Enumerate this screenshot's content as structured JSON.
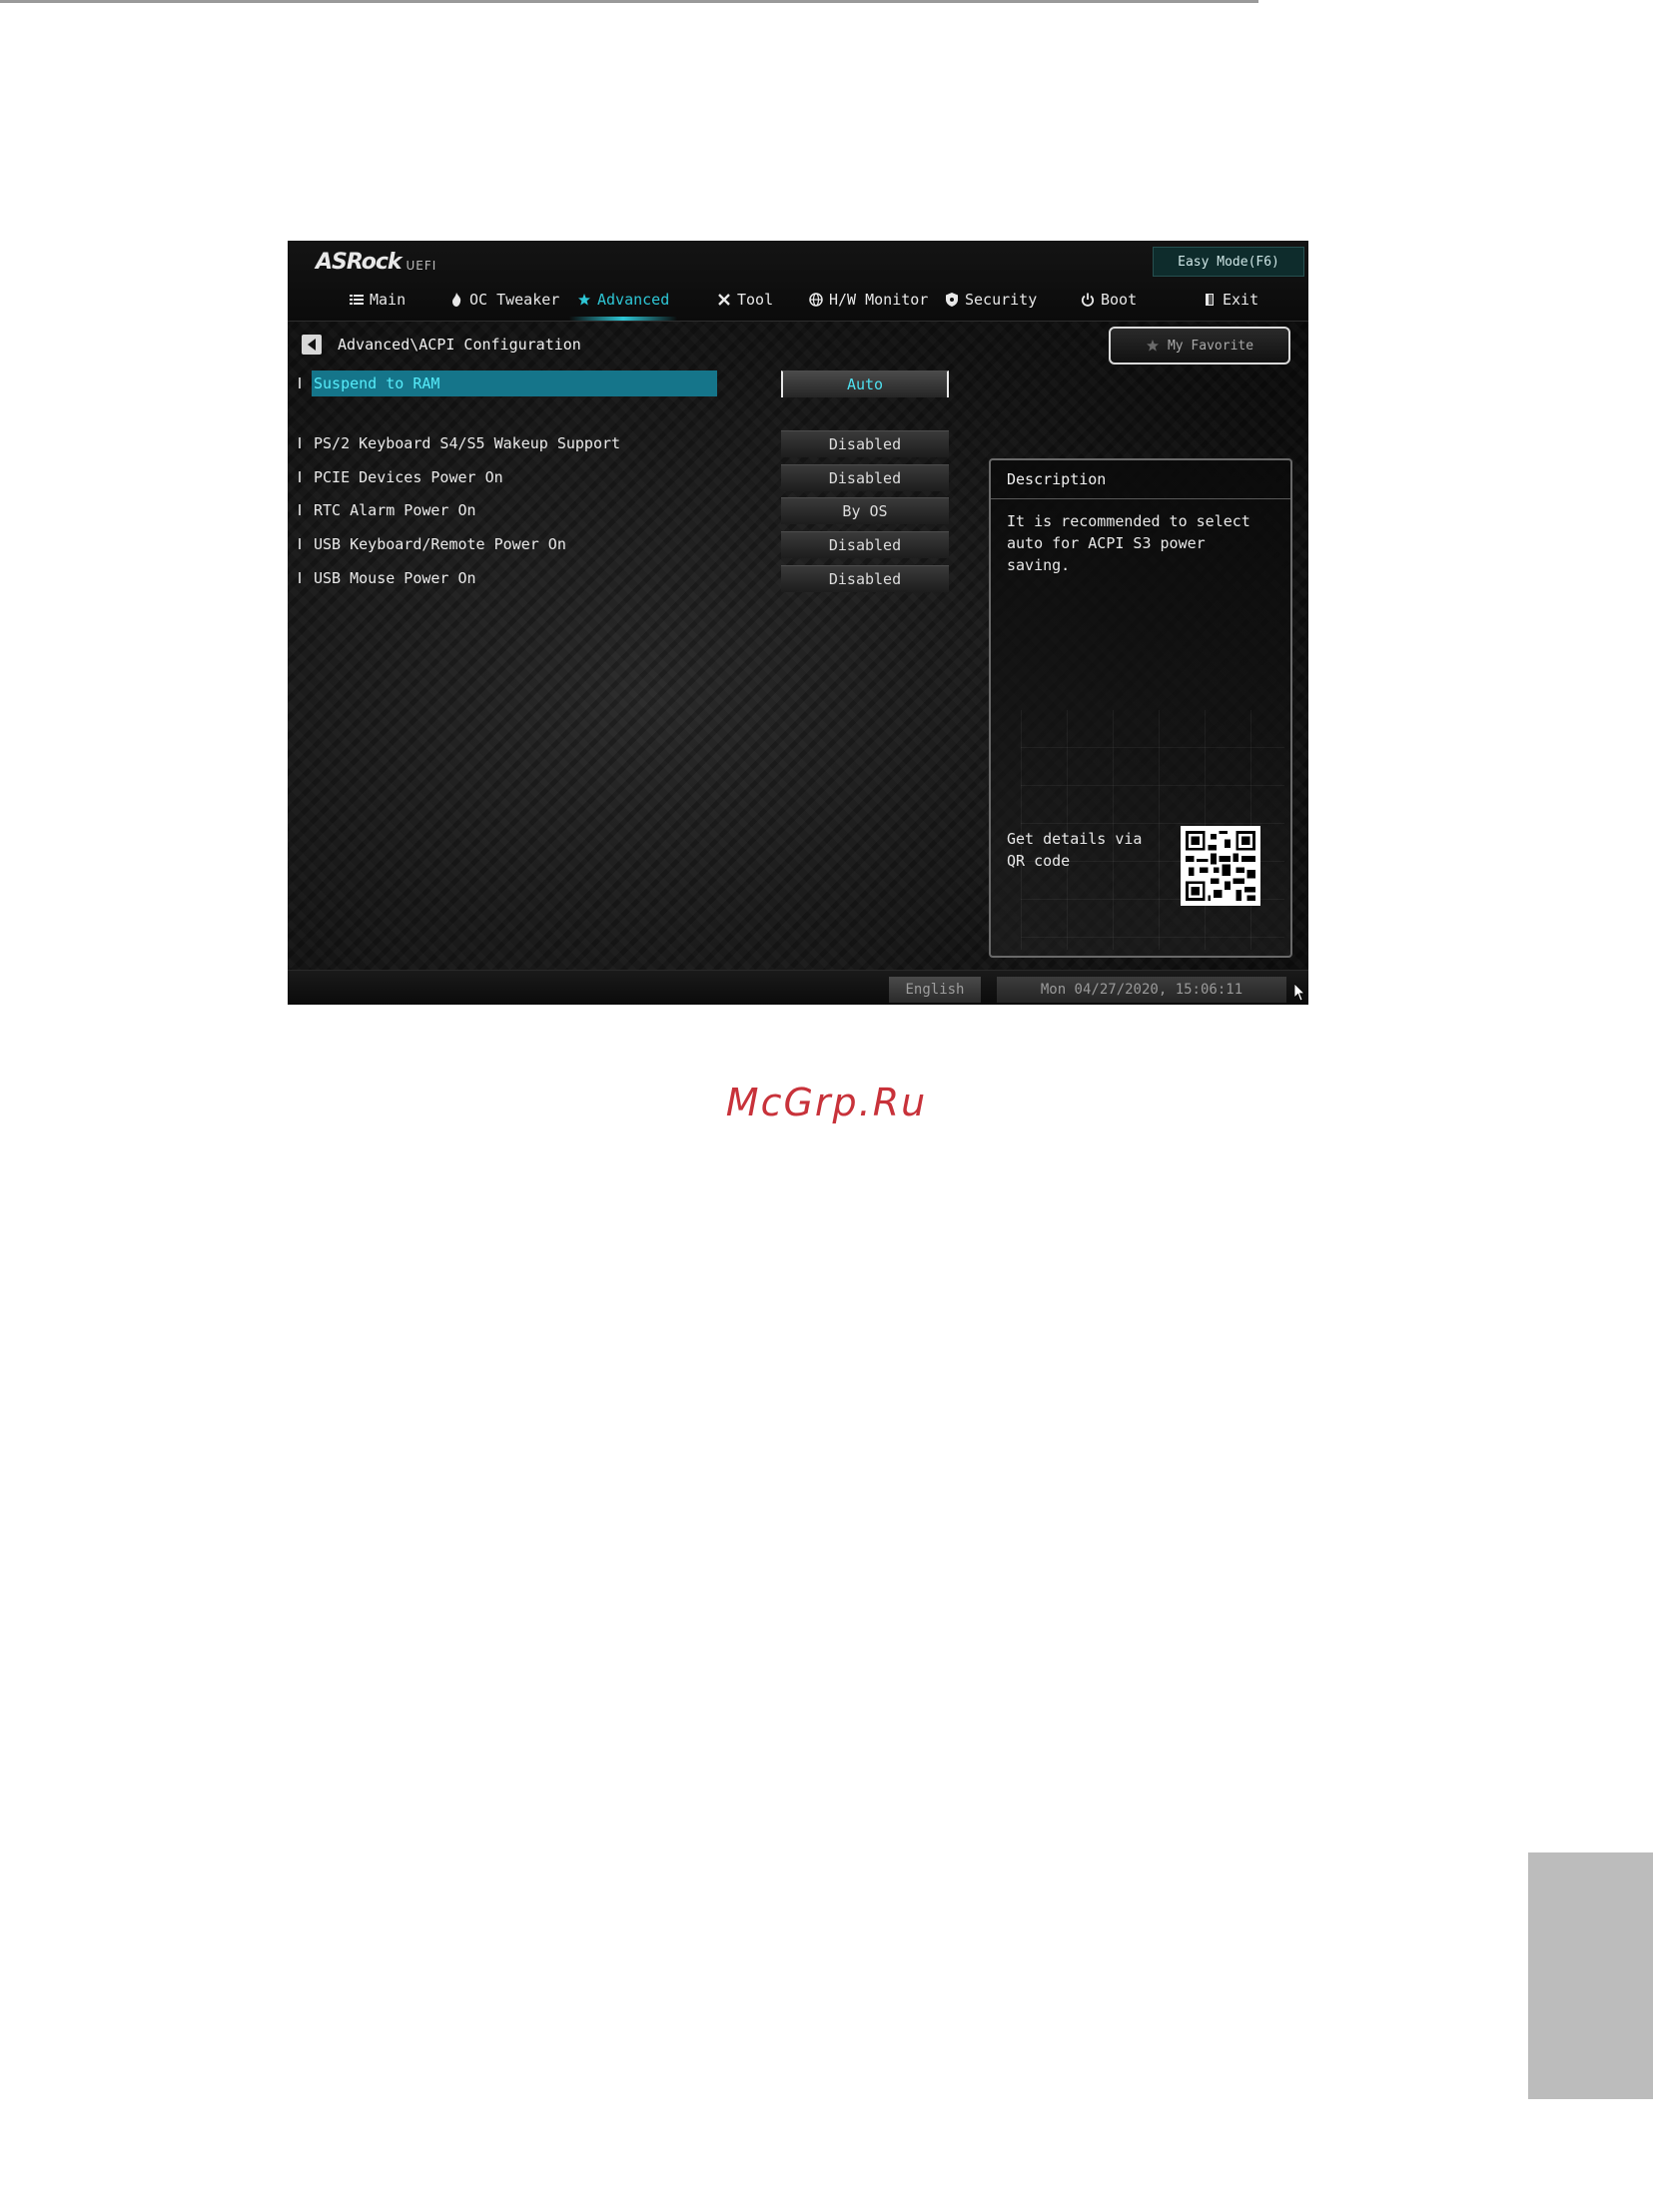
{
  "header": {
    "brand": "ASRock",
    "brand_sub": "UEFI",
    "easy_mode": "Easy Mode(F6)"
  },
  "tabs": [
    {
      "label": "Main",
      "icon": "list-icon"
    },
    {
      "label": "OC Tweaker",
      "icon": "flame-icon"
    },
    {
      "label": "Advanced",
      "icon": "star-icon",
      "active": true
    },
    {
      "label": "Tool",
      "icon": "tools-icon"
    },
    {
      "label": "H/W Monitor",
      "icon": "globe-icon"
    },
    {
      "label": "Security",
      "icon": "shield-icon"
    },
    {
      "label": "Boot",
      "icon": "power-icon"
    },
    {
      "label": "Exit",
      "icon": "door-icon"
    }
  ],
  "breadcrumb": "Advanced\\ACPI Configuration",
  "favorite_label": "My Favorite",
  "settings": [
    {
      "label": "Suspend to RAM",
      "value": "Auto",
      "selected": true
    },
    {
      "label": "PS/2 Keyboard S4/S5 Wakeup Support",
      "value": "Disabled"
    },
    {
      "label": "PCIE Devices Power On",
      "value": "Disabled"
    },
    {
      "label": "RTC Alarm Power On",
      "value": "By OS"
    },
    {
      "label": "USB Keyboard/Remote Power On",
      "value": "Disabled"
    },
    {
      "label": "USB Mouse Power On",
      "value": "Disabled"
    }
  ],
  "description": {
    "title": "Description",
    "text": "It is recommended to select auto for ACPI S3 power saving.",
    "qr_text": "Get details via QR code"
  },
  "footer": {
    "language": "English",
    "datetime": "Mon 04/27/2020, 15:06:11"
  },
  "watermark": "McGrp.Ru",
  "colors": {
    "accent": "#2ec7d6",
    "selected_row": "#15758a"
  }
}
